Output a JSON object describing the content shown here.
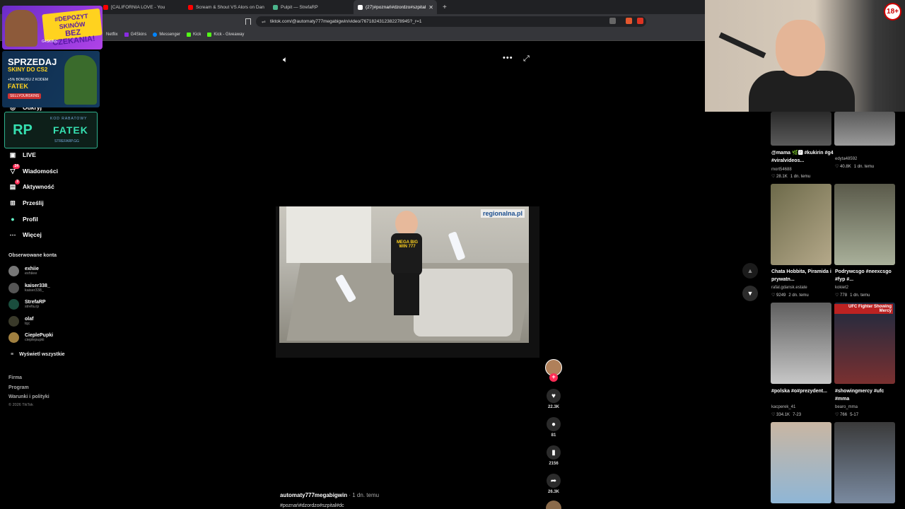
{
  "browser": {
    "tabs": [
      {
        "label": "[CALIFORNIA LOVE - You",
        "color": "#ff0000"
      },
      {
        "label": "Scream & Shout VS Alors on Dan",
        "color": "#ff0000"
      },
      {
        "label": "Pulpit — StrefaRP",
        "color": "#4bb58c"
      },
      {
        "label": "(27)#poznań#dzordzo#szpital",
        "color": "#ffffff",
        "active": true
      }
    ],
    "new_tab": "+",
    "url": "tiktok.com/@automaty777megabigwin/video/7671824312382278945?_r=1",
    "bookmarks": [
      {
        "label": "Netflix",
        "color": "#e50914"
      },
      {
        "label": "G4Skins",
        "color": "#8a2be2"
      },
      {
        "label": "Messenger",
        "color": "#0084ff"
      },
      {
        "label": "Kick",
        "color": "#53fc18"
      },
      {
        "label": "Kick - Giveaway",
        "color": "#53fc18"
      }
    ]
  },
  "promos": {
    "p1": {
      "line1": "#DEPOZYT SKINÓW",
      "line2": "BEZ CZEKANIA!",
      "brand": "G4SKINS"
    },
    "p2": {
      "line1": "SPRZEDAJ",
      "line2": "SKINY DO CS2",
      "line3": "+5% BONUSU Z KODEM",
      "code": "FATEK",
      "brand": "SELLYOURSKINS"
    },
    "p3": {
      "label": "KOD RABATOWY",
      "code": "FATEK",
      "site": "STREFARP.GG",
      "logo": "RP"
    }
  },
  "sidebar": {
    "nav": [
      {
        "label": "Odkryj",
        "icon": "compass-icon",
        "glyph": "◎"
      },
      {
        "label": "LIVE",
        "icon": "live-icon",
        "glyph": "▣"
      },
      {
        "label": "Wiadomości",
        "icon": "messages-icon",
        "glyph": "▽",
        "badge": "24"
      },
      {
        "label": "Aktywność",
        "icon": "activity-icon",
        "glyph": "▤",
        "badge": "3"
      },
      {
        "label": "Prześlij",
        "icon": "upload-icon",
        "glyph": "⊞"
      },
      {
        "label": "Profil",
        "icon": "profile-icon",
        "glyph": "●"
      },
      {
        "label": "Więcej",
        "icon": "more-icon",
        "glyph": "⋯"
      }
    ],
    "following_title": "Obserwowane konta",
    "accounts": [
      {
        "name": "exhiie",
        "handle": "exhiiee",
        "color": "#777"
      },
      {
        "name": "kaiser338_",
        "handle": "kaiser338_",
        "color": "#555"
      },
      {
        "name": "StrefaRP",
        "handle": "strefa.rp",
        "color": "#1a4d3d"
      },
      {
        "name": "olaf",
        "handle": "tqc",
        "color": "#3a3a2a"
      },
      {
        "name": "CieplePupki",
        "handle": "cieplepupki",
        "color": "#a08040"
      }
    ],
    "show_all": "Wyświetl wszystkie",
    "footer": [
      "Firma",
      "Program",
      "Warunki i polityki"
    ],
    "copyright": "© 2026 TikTok"
  },
  "video": {
    "watermark": "regionalna.pl",
    "shirt_text": "MEGA BIG WIN 777",
    "author": "automaty777megabigwin",
    "when": " · 1 dn. temu",
    "caption": "#poznań#dzordzo#szpital#dc"
  },
  "actions": {
    "likes": "22.3K",
    "comments": "81",
    "saves": "2156",
    "shares": "26.3K"
  },
  "grid": [
    {
      "caption": "@mama 🌿🅿 #kukirin #g4 #viralvideos...",
      "user": "mort54688",
      "views": "28.1K",
      "ago": "1 dn. temu",
      "c1": "#3a3a3a",
      "c2": "#6e6e6e"
    },
    {
      "caption": "",
      "user": "edyta48592",
      "views": "40.8K",
      "ago": "1 dn. temu",
      "c1": "#7a7a7a",
      "c2": "#cfcfcf"
    },
    {
      "caption": "Chata Hobbita, Piramida i prywatn...",
      "user": "rafal.gdansk.estate",
      "views": "9249",
      "ago": "2 dn. temu",
      "c1": "#6d6a4a",
      "c2": "#b5a98a"
    },
    {
      "caption": "Podrywcsgo #neexcsgo #fyp #...",
      "user": "kokiet2",
      "views": "778",
      "ago": "1 dn. temu",
      "c1": "#5a5a4a",
      "c2": "#a9b09a"
    },
    {
      "caption": "#polska #o#prezydent...",
      "user": "kacperek_41",
      "views": "334.1K",
      "ago": "7-23",
      "c1": "#5f5f5f",
      "c2": "#c7c7c7"
    },
    {
      "caption": "#showingmercy #ufc #mma",
      "user": "bearo_mma",
      "views": "766",
      "ago": "5-17",
      "c1": "#1c2a40",
      "c2": "#7a3030"
    },
    {
      "caption": "",
      "user": "",
      "views": "",
      "ago": "",
      "c1": "#c9b6a2",
      "c2": "#8fb6d6"
    },
    {
      "caption": "",
      "user": "",
      "views": "",
      "ago": "",
      "c1": "#3a3a3a",
      "c2": "#7a8aa0"
    }
  ],
  "top_thumbs": [
    {
      "caption": "",
      "c1": "#2a2a2a",
      "c2": "#5a5a5a"
    },
    {
      "caption": "",
      "c1": "#5a5a5a",
      "c2": "#9a9a9a"
    }
  ],
  "overlay_badge": "18+",
  "thumb_overlay_text": "UFC Fighter Showing Mercy"
}
